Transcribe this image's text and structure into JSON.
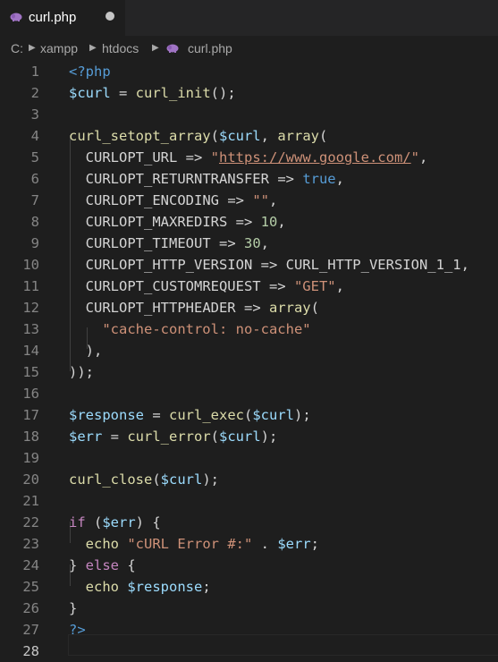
{
  "tab": {
    "label": "curl.php",
    "modified": true
  },
  "breadcrumbs": [
    "C:",
    "xampp",
    "htdocs",
    "curl.php"
  ],
  "editor": {
    "active_line": 28,
    "line_numbers": [
      "1",
      "2",
      "3",
      "4",
      "5",
      "6",
      "7",
      "8",
      "9",
      "10",
      "11",
      "12",
      "13",
      "14",
      "15",
      "16",
      "17",
      "18",
      "19",
      "20",
      "21",
      "22",
      "23",
      "24",
      "25",
      "26",
      "27",
      "28"
    ],
    "lines": [
      [
        {
          "t": "kw",
          "v": "<?php"
        }
      ],
      [
        {
          "t": "var",
          "v": "$curl"
        },
        {
          "t": "p",
          "v": " = "
        },
        {
          "t": "fn",
          "v": "curl_init"
        },
        {
          "t": "p",
          "v": "();"
        }
      ],
      [],
      [
        {
          "t": "fn",
          "v": "curl_setopt_array"
        },
        {
          "t": "p",
          "v": "("
        },
        {
          "t": "var",
          "v": "$curl"
        },
        {
          "t": "p",
          "v": ", "
        },
        {
          "t": "fn",
          "v": "array"
        },
        {
          "t": "p",
          "v": "("
        }
      ],
      [
        {
          "t": "p",
          "v": "  "
        },
        {
          "t": "c",
          "v": "CURLOPT_URL"
        },
        {
          "t": "p",
          "v": " => "
        },
        {
          "t": "str",
          "v": "\""
        },
        {
          "t": "url",
          "v": "https://www.google.com/"
        },
        {
          "t": "str",
          "v": "\""
        },
        {
          "t": "p",
          "v": ","
        }
      ],
      [
        {
          "t": "p",
          "v": "  "
        },
        {
          "t": "c",
          "v": "CURLOPT_RETURNTRANSFER"
        },
        {
          "t": "p",
          "v": " => "
        },
        {
          "t": "kw",
          "v": "true"
        },
        {
          "t": "p",
          "v": ","
        }
      ],
      [
        {
          "t": "p",
          "v": "  "
        },
        {
          "t": "c",
          "v": "CURLOPT_ENCODING"
        },
        {
          "t": "p",
          "v": " => "
        },
        {
          "t": "str",
          "v": "\"\""
        },
        {
          "t": "p",
          "v": ","
        }
      ],
      [
        {
          "t": "p",
          "v": "  "
        },
        {
          "t": "c",
          "v": "CURLOPT_MAXREDIRS"
        },
        {
          "t": "p",
          "v": " => "
        },
        {
          "t": "num",
          "v": "10"
        },
        {
          "t": "p",
          "v": ","
        }
      ],
      [
        {
          "t": "p",
          "v": "  "
        },
        {
          "t": "c",
          "v": "CURLOPT_TIMEOUT"
        },
        {
          "t": "p",
          "v": " => "
        },
        {
          "t": "num",
          "v": "30"
        },
        {
          "t": "p",
          "v": ","
        }
      ],
      [
        {
          "t": "p",
          "v": "  "
        },
        {
          "t": "c",
          "v": "CURLOPT_HTTP_VERSION"
        },
        {
          "t": "p",
          "v": " => "
        },
        {
          "t": "c",
          "v": "CURL_HTTP_VERSION_1_1"
        },
        {
          "t": "p",
          "v": ","
        }
      ],
      [
        {
          "t": "p",
          "v": "  "
        },
        {
          "t": "c",
          "v": "CURLOPT_CUSTOMREQUEST"
        },
        {
          "t": "p",
          "v": " => "
        },
        {
          "t": "str",
          "v": "\"GET\""
        },
        {
          "t": "p",
          "v": ","
        }
      ],
      [
        {
          "t": "p",
          "v": "  "
        },
        {
          "t": "c",
          "v": "CURLOPT_HTTPHEADER"
        },
        {
          "t": "p",
          "v": " => "
        },
        {
          "t": "fn",
          "v": "array"
        },
        {
          "t": "p",
          "v": "("
        }
      ],
      [
        {
          "t": "p",
          "v": "    "
        },
        {
          "t": "str",
          "v": "\"cache-control: no-cache\""
        }
      ],
      [
        {
          "t": "p",
          "v": "  ),"
        }
      ],
      [
        {
          "t": "p",
          "v": "));"
        }
      ],
      [],
      [
        {
          "t": "var",
          "v": "$response"
        },
        {
          "t": "p",
          "v": " = "
        },
        {
          "t": "fn",
          "v": "curl_exec"
        },
        {
          "t": "p",
          "v": "("
        },
        {
          "t": "var",
          "v": "$curl"
        },
        {
          "t": "p",
          "v": ");"
        }
      ],
      [
        {
          "t": "var",
          "v": "$err"
        },
        {
          "t": "p",
          "v": " = "
        },
        {
          "t": "fn",
          "v": "curl_error"
        },
        {
          "t": "p",
          "v": "("
        },
        {
          "t": "var",
          "v": "$curl"
        },
        {
          "t": "p",
          "v": ");"
        }
      ],
      [],
      [
        {
          "t": "fn",
          "v": "curl_close"
        },
        {
          "t": "p",
          "v": "("
        },
        {
          "t": "var",
          "v": "$curl"
        },
        {
          "t": "p",
          "v": ");"
        }
      ],
      [],
      [
        {
          "t": "ctl",
          "v": "if"
        },
        {
          "t": "p",
          "v": " ("
        },
        {
          "t": "var",
          "v": "$err"
        },
        {
          "t": "p",
          "v": ") {"
        }
      ],
      [
        {
          "t": "p",
          "v": "  "
        },
        {
          "t": "fn",
          "v": "echo"
        },
        {
          "t": "p",
          "v": " "
        },
        {
          "t": "str",
          "v": "\"cURL Error #:\""
        },
        {
          "t": "p",
          "v": " . "
        },
        {
          "t": "var",
          "v": "$err"
        },
        {
          "t": "p",
          "v": ";"
        }
      ],
      [
        {
          "t": "p",
          "v": "} "
        },
        {
          "t": "ctl",
          "v": "else"
        },
        {
          "t": "p",
          "v": " {"
        }
      ],
      [
        {
          "t": "p",
          "v": "  "
        },
        {
          "t": "fn",
          "v": "echo"
        },
        {
          "t": "p",
          "v": " "
        },
        {
          "t": "var",
          "v": "$response"
        },
        {
          "t": "p",
          "v": ";"
        }
      ],
      [
        {
          "t": "p",
          "v": "}"
        }
      ],
      [
        {
          "t": "kw",
          "v": "?>"
        }
      ],
      []
    ]
  },
  "colors": {
    "background": "#1e1e1e",
    "tabbar": "#252526",
    "keyword": "#569cd6",
    "variable": "#9cdcfe",
    "function": "#dcdcaa",
    "string": "#ce9178",
    "control": "#c586c0",
    "number": "#b5cea8"
  },
  "icons": {
    "file_icon": "php-elephant-icon",
    "breadcrumb_separator": "chevron-right-icon"
  }
}
